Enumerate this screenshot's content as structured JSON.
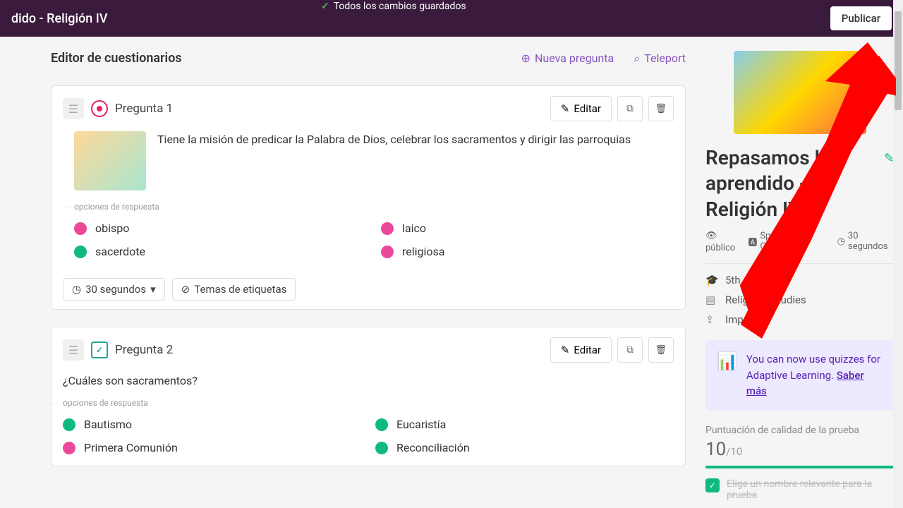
{
  "header": {
    "title_fragment": "dido - Religión IV",
    "save_status": "Todos los cambios guardados",
    "publish": "Publicar"
  },
  "editor": {
    "title": "Editor de cuestionarios",
    "new_question": "Nueva pregunta",
    "teleport": "Teleport"
  },
  "questions": [
    {
      "label": "Pregunta 1",
      "edit": "Editar",
      "text": "Tiene la misión de predicar la Palabra de Dios, celebrar los sacramentos y dirigir las parroquias",
      "options_label": "opciones de respuesta",
      "options": [
        {
          "text": "obispo",
          "color": "pink"
        },
        {
          "text": "laico",
          "color": "pink"
        },
        {
          "text": "sacerdote",
          "color": "green"
        },
        {
          "text": "religiosa",
          "color": "pink"
        }
      ],
      "time": "30 segundos",
      "tags": "Temas de etiquetas"
    },
    {
      "label": "Pregunta 2",
      "edit": "Editar",
      "text": "¿Cuáles son sacramentos?",
      "options_label": "opciones de respuesta",
      "options": [
        {
          "text": "Bautismo",
          "color": "green"
        },
        {
          "text": "Eucaristía",
          "color": "green"
        },
        {
          "text": "Primera Comunión",
          "color": "pink"
        },
        {
          "text": "Reconciliación",
          "color": "green"
        }
      ]
    }
  ],
  "sidebar": {
    "quiz_title": "Repasamos lo aprendido - Religión IV",
    "visibility": "público",
    "language": "Spanish; Castilian",
    "duration": "30 segundos",
    "grade": "5th curso",
    "subject": "Religious Studies",
    "import": "Importar",
    "info_text": "You can now use quizzes for Adaptive Learning. ",
    "info_link": "Saber más",
    "score_label": "Puntuación de calidad de la prueba",
    "score_value": "10",
    "score_denom": "/10",
    "score_item": "Elige un nombre relevante para la prueba"
  }
}
